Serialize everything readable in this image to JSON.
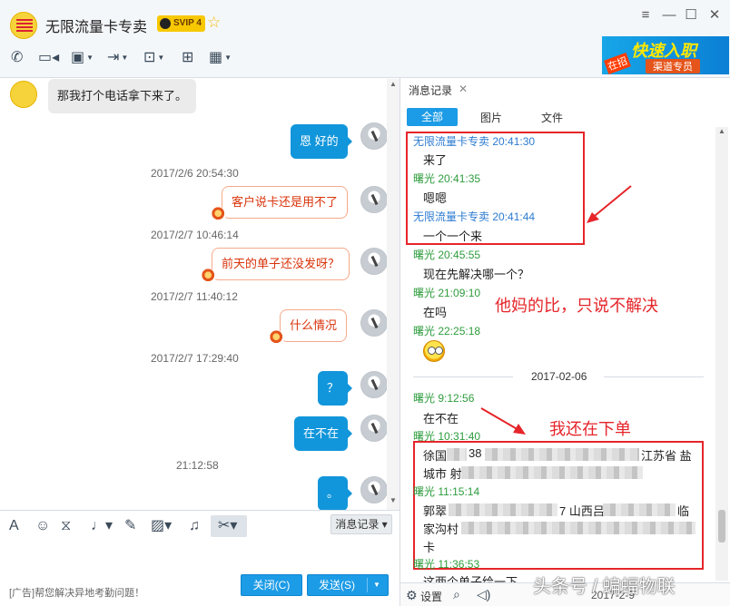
{
  "window": {
    "title": "无限流量卡专卖",
    "vip_badge": "SVIP 4",
    "controls": {
      "menu": "≡",
      "minimize": "—",
      "maximize": "☐",
      "close": "✕"
    }
  },
  "toolbar": {
    "icons": [
      "phone-icon",
      "video-icon",
      "screen-share-icon",
      "file-transfer-icon",
      "remote-assist-icon",
      "message-board-icon",
      "apps-icon"
    ]
  },
  "ad_banner": {
    "headline": "快速入职",
    "subline": "渠道专员",
    "tag": "在招"
  },
  "chat": {
    "messages": [
      {
        "side": "left",
        "text": "那我打个电话拿下来了。"
      },
      {
        "side": "right",
        "style": "blue",
        "text": "恩 好的"
      },
      {
        "timestamp": "2017/2/6 20:54:30"
      },
      {
        "side": "right",
        "style": "orange",
        "text": "客户说卡还是用不了"
      },
      {
        "timestamp": "2017/2/7 10:46:14"
      },
      {
        "side": "right",
        "style": "orange",
        "text": "前天的单子还没发呀？"
      },
      {
        "timestamp": "2017/2/7 11:40:12"
      },
      {
        "side": "right",
        "style": "orange",
        "text": "什么情况"
      },
      {
        "timestamp": "2017/2/7 17:29:40"
      },
      {
        "side": "right",
        "style": "blue",
        "text": "？"
      },
      {
        "side": "right",
        "style": "blue",
        "text": "在不在"
      },
      {
        "timestamp": "21:12:58"
      },
      {
        "side": "right",
        "style": "blue",
        "text": "。"
      }
    ]
  },
  "input_toolbar": {
    "icons": [
      "font-icon",
      "emoji-icon",
      "gif-icon",
      "voice-icon",
      "pen-icon",
      "image-icon",
      "music-icon",
      "scissors-icon"
    ],
    "history_button": "消息记录"
  },
  "bottom": {
    "ad_link": "[广告]帮您解决异地考勤问题！",
    "close_button": "关闭(C)",
    "send_button": "发送(S)"
  },
  "history": {
    "tab_label": "消息记录",
    "filters": {
      "all": "全部",
      "image": "图片",
      "file": "文件"
    },
    "entries": [
      {
        "name": "无限流量卡专卖 20:41:30",
        "color": "blue",
        "text": "来了"
      },
      {
        "name": "曙光 20:41:35",
        "color": "green",
        "text": "嗯嗯"
      },
      {
        "name": "无限流量卡专卖 20:41:44",
        "color": "blue",
        "text": "一个一个来"
      },
      {
        "name": "曙光 20:45:55",
        "color": "green",
        "text": "现在先解决哪一个？"
      },
      {
        "name": "曙光 21:09:10",
        "color": "green",
        "text": "在吗"
      },
      {
        "name": "曙光 22:25:18",
        "color": "green",
        "text": ""
      }
    ],
    "date_separator": "2017-02-06",
    "entries2": [
      {
        "name": "曙光 9:12:56",
        "text": "在不在"
      },
      {
        "name": "曙光 10:31:40",
        "line1a": "徐国",
        "line1b": "38",
        "line1c": "江苏省 盐",
        "line2": "城市 射"
      },
      {
        "name": "曙光 11:15:14",
        "line1a": "郭翠",
        "line1b": "7 山西吕",
        "line1c": "临",
        "line2": "家沟村",
        "line3": "卡"
      },
      {
        "name": "曙光 11:36:53",
        "text": "这两个单子给一下"
      }
    ],
    "annotation_1": "他妈的比，只说不解决",
    "annotation_2": "我还在下单",
    "bottom_settings": "设置",
    "bottom_date": "2017-2-9"
  },
  "watermark": "头条号 / 蝙蝠物联",
  "colors": {
    "accent": "#1c9be6",
    "annotation": "#e5252a",
    "self_name": "#2e9c3d",
    "other_name": "#2c7bd1"
  }
}
